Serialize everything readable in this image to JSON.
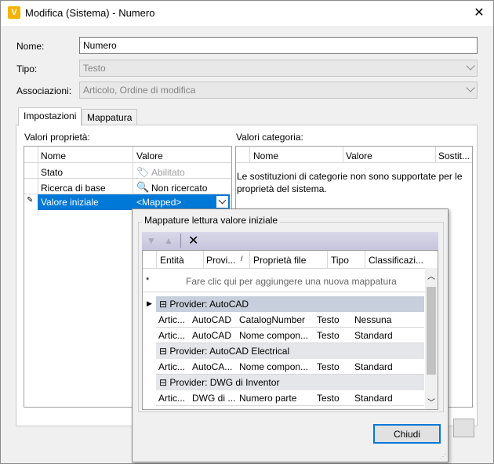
{
  "window": {
    "title": "Modifica (Sistema) - Numero",
    "app_icon": "V"
  },
  "form": {
    "name_label": "Nome:",
    "name_value": "Numero",
    "type_label": "Tipo:",
    "type_value": "Testo",
    "assoc_label": "Associazioni:",
    "assoc_value": "Articolo, Ordine di modifica"
  },
  "tabs": [
    "Impostazioni",
    "Mappatura"
  ],
  "props": {
    "title": "Valori proprietà:",
    "headers": [
      "Nome",
      "Valore"
    ],
    "rows": [
      {
        "name": "Stato",
        "value": "Abilitato"
      },
      {
        "name": "Ricerca di base",
        "value": "Non ricercato"
      },
      {
        "name": "Valore iniziale",
        "value": "<Mapped>"
      }
    ]
  },
  "categories": {
    "title": "Valori categoria:",
    "headers": [
      "Nome",
      "Valore",
      "Sostit..."
    ],
    "message": "Le sostituzioni di categorie non sono supportate per le proprietà del sistema."
  },
  "popup": {
    "group_title": "Mappature lettura valore iniziale",
    "headers": [
      "Entità",
      "Provi...",
      "Proprietà file",
      "Tipo",
      "Classificazi..."
    ],
    "add_hint": "Fare clic qui per aggiungere una nuova mappatura",
    "providers": [
      {
        "title": "Provider: AutoCAD",
        "rows": [
          [
            "Artic...",
            "AutoCAD",
            "CatalogNumber",
            "Testo",
            "Nessuna"
          ],
          [
            "Artic...",
            "AutoCAD",
            "Nome compon...",
            "Testo",
            "Standard"
          ]
        ]
      },
      {
        "title": "Provider: AutoCAD Electrical",
        "rows": [
          [
            "Artic...",
            "AutoCA...",
            "Nome compon...",
            "Testo",
            "Standard"
          ]
        ]
      },
      {
        "title": "Provider: DWG di Inventor",
        "rows": [
          [
            "Artic...",
            "DWG di ...",
            "Numero parte",
            "Testo",
            "Standard"
          ]
        ]
      }
    ],
    "close_label": "Chiudi"
  }
}
